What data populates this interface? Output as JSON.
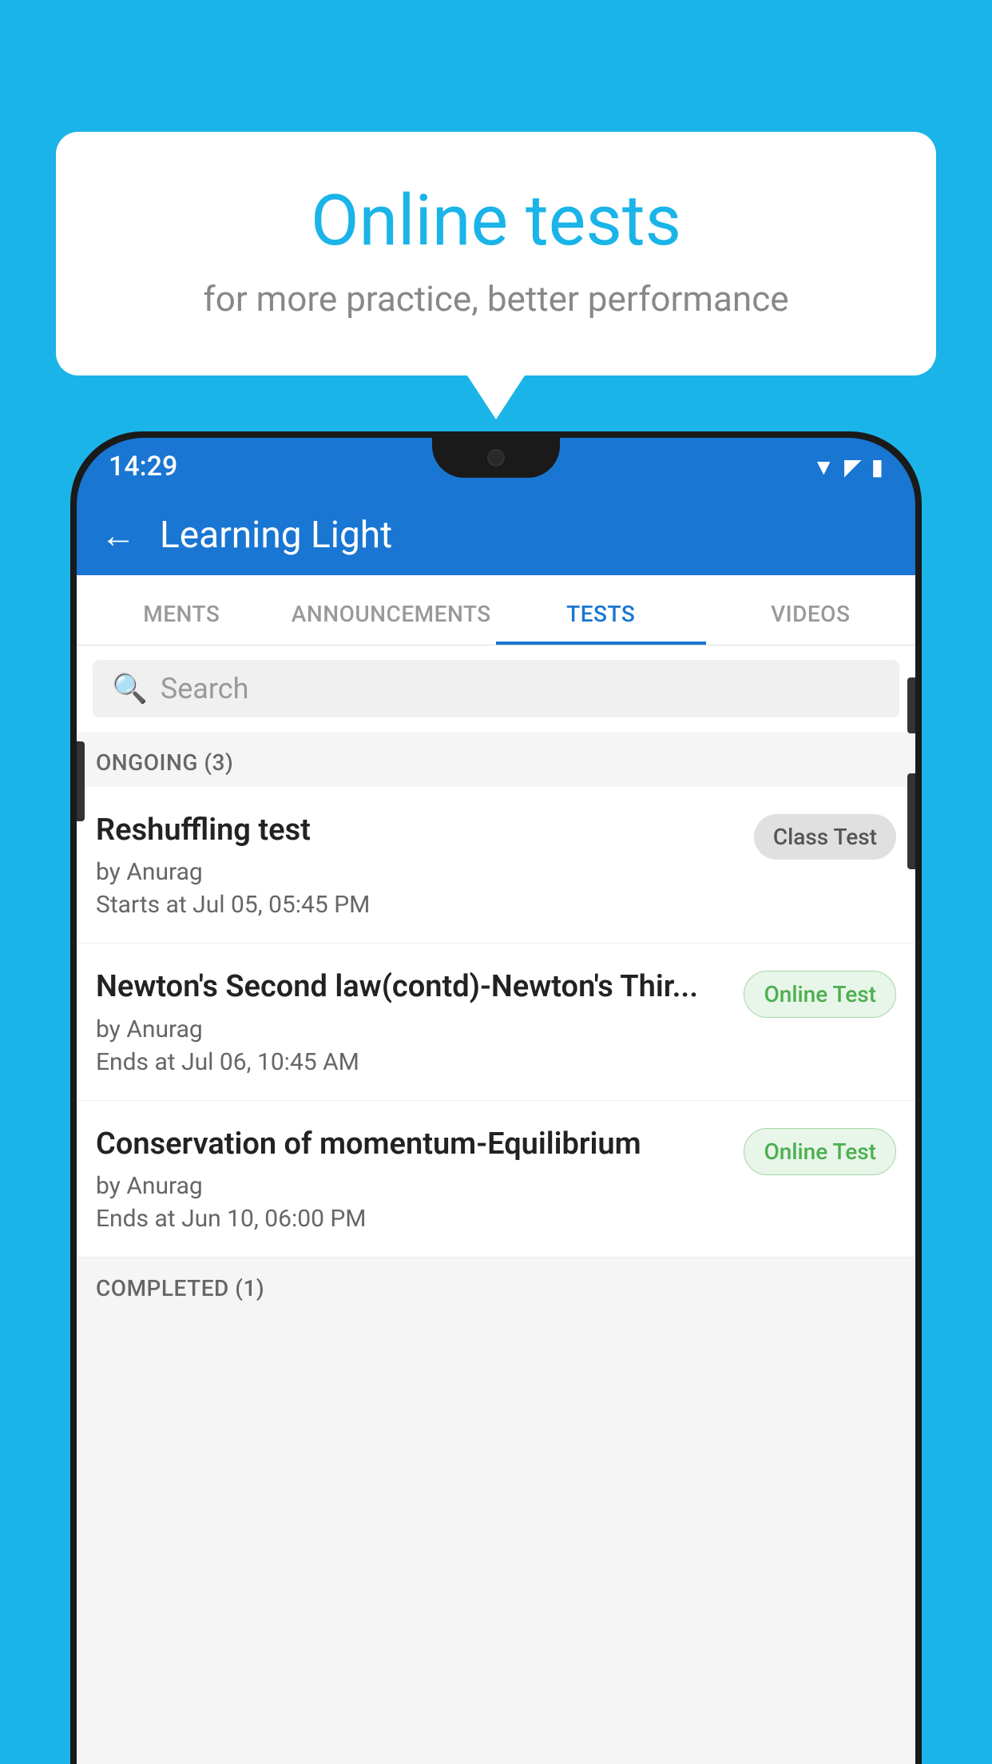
{
  "background_color": "#1ab4e8",
  "speech_bubble": {
    "title": "Online tests",
    "subtitle": "for more practice, better performance"
  },
  "phone": {
    "status_bar": {
      "time": "14:29",
      "icons": [
        "wifi",
        "signal",
        "battery"
      ]
    },
    "app_header": {
      "title": "Learning Light",
      "back_label": "←"
    },
    "tabs": [
      {
        "label": "MENTS",
        "active": false
      },
      {
        "label": "ANNOUNCEMENTS",
        "active": false
      },
      {
        "label": "TESTS",
        "active": true
      },
      {
        "label": "VIDEOS",
        "active": false
      }
    ],
    "search": {
      "placeholder": "Search"
    },
    "ongoing_section": {
      "label": "ONGOING (3)",
      "items": [
        {
          "name": "Reshuffling test",
          "author": "by Anurag",
          "time_label": "Starts at",
          "time": "Jul 05, 05:45 PM",
          "badge": "Class Test",
          "badge_type": "class"
        },
        {
          "name": "Newton's Second law(contd)-Newton's Thir...",
          "author": "by Anurag",
          "time_label": "Ends at",
          "time": "Jul 06, 10:45 AM",
          "badge": "Online Test",
          "badge_type": "online"
        },
        {
          "name": "Conservation of momentum-Equilibrium",
          "author": "by Anurag",
          "time_label": "Ends at",
          "time": "Jun 10, 06:00 PM",
          "badge": "Online Test",
          "badge_type": "online"
        }
      ]
    },
    "completed_section": {
      "label": "COMPLETED (1)"
    }
  }
}
